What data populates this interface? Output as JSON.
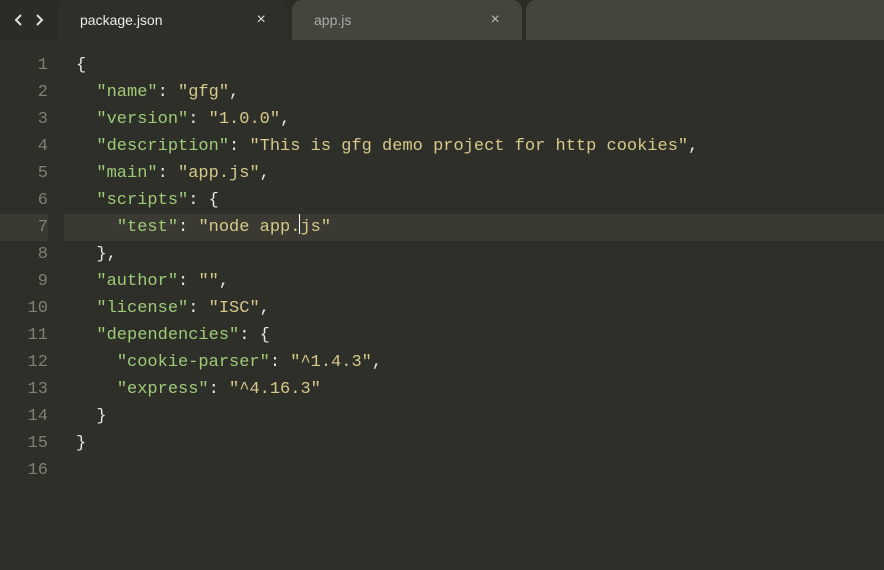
{
  "tabs": [
    {
      "label": "package.json",
      "active": true
    },
    {
      "label": "app.js",
      "active": false
    }
  ],
  "active_line": 7,
  "cursor": {
    "line": 7,
    "after_char_index": 22
  },
  "line_count": 16,
  "code_lines": [
    {
      "n": 1,
      "indent": "",
      "tokens": [
        {
          "t": "punc",
          "v": "{"
        }
      ]
    },
    {
      "n": 2,
      "indent": "  ",
      "tokens": [
        {
          "t": "key",
          "v": "\"name\""
        },
        {
          "t": "punc",
          "v": ": "
        },
        {
          "t": "str",
          "v": "\"gfg\""
        },
        {
          "t": "punc",
          "v": ","
        }
      ]
    },
    {
      "n": 3,
      "indent": "  ",
      "tokens": [
        {
          "t": "key",
          "v": "\"version\""
        },
        {
          "t": "punc",
          "v": ": "
        },
        {
          "t": "str",
          "v": "\"1.0.0\""
        },
        {
          "t": "punc",
          "v": ","
        }
      ]
    },
    {
      "n": 4,
      "indent": "  ",
      "tokens": [
        {
          "t": "key",
          "v": "\"description\""
        },
        {
          "t": "punc",
          "v": ": "
        },
        {
          "t": "str",
          "v": "\"This is gfg demo project for http cookies\""
        },
        {
          "t": "punc",
          "v": ","
        }
      ]
    },
    {
      "n": 5,
      "indent": "  ",
      "tokens": [
        {
          "t": "key",
          "v": "\"main\""
        },
        {
          "t": "punc",
          "v": ": "
        },
        {
          "t": "str",
          "v": "\"app.js\""
        },
        {
          "t": "punc",
          "v": ","
        }
      ]
    },
    {
      "n": 6,
      "indent": "  ",
      "tokens": [
        {
          "t": "key",
          "v": "\"scripts\""
        },
        {
          "t": "punc",
          "v": ": "
        },
        {
          "t": "punc",
          "v": "{"
        }
      ]
    },
    {
      "n": 7,
      "indent": "    ",
      "tokens": [
        {
          "t": "key",
          "v": "\"test\""
        },
        {
          "t": "punc",
          "v": ": "
        },
        {
          "t": "str",
          "v": "\"node app.js\""
        }
      ]
    },
    {
      "n": 8,
      "indent": "  ",
      "tokens": [
        {
          "t": "punc",
          "v": "},"
        }
      ]
    },
    {
      "n": 9,
      "indent": "  ",
      "tokens": [
        {
          "t": "key",
          "v": "\"author\""
        },
        {
          "t": "punc",
          "v": ": "
        },
        {
          "t": "str",
          "v": "\"\""
        },
        {
          "t": "punc",
          "v": ","
        }
      ]
    },
    {
      "n": 10,
      "indent": "  ",
      "tokens": [
        {
          "t": "key",
          "v": "\"license\""
        },
        {
          "t": "punc",
          "v": ": "
        },
        {
          "t": "str",
          "v": "\"ISC\""
        },
        {
          "t": "punc",
          "v": ","
        }
      ]
    },
    {
      "n": 11,
      "indent": "  ",
      "tokens": [
        {
          "t": "key",
          "v": "\"dependencies\""
        },
        {
          "t": "punc",
          "v": ": "
        },
        {
          "t": "punc",
          "v": "{"
        }
      ]
    },
    {
      "n": 12,
      "indent": "    ",
      "tokens": [
        {
          "t": "key",
          "v": "\"cookie-parser\""
        },
        {
          "t": "punc",
          "v": ": "
        },
        {
          "t": "str",
          "v": "\"^1.4.3\""
        },
        {
          "t": "punc",
          "v": ","
        }
      ]
    },
    {
      "n": 13,
      "indent": "    ",
      "tokens": [
        {
          "t": "key",
          "v": "\"express\""
        },
        {
          "t": "punc",
          "v": ": "
        },
        {
          "t": "str",
          "v": "\"^4.16.3\""
        }
      ]
    },
    {
      "n": 14,
      "indent": "  ",
      "tokens": [
        {
          "t": "punc",
          "v": "}"
        }
      ]
    },
    {
      "n": 15,
      "indent": "",
      "tokens": [
        {
          "t": "punc",
          "v": "}"
        }
      ]
    },
    {
      "n": 16,
      "indent": "",
      "tokens": []
    }
  ]
}
